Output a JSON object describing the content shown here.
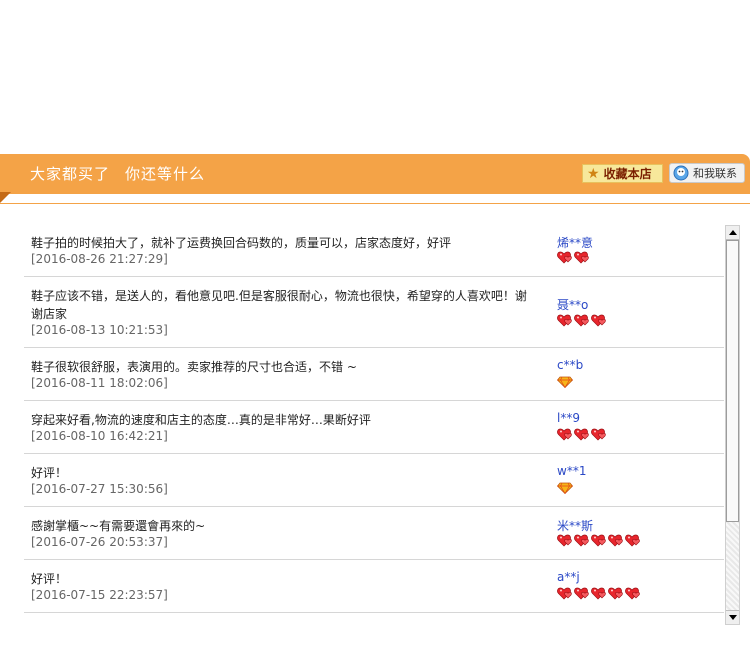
{
  "header": {
    "slogan_1": "大家都买了",
    "slogan_2": "你还等什么",
    "favorite_label": "收藏本店",
    "contact_label": "和我联系",
    "accent": "#f4a347"
  },
  "reviews": [
    {
      "comment": "鞋子拍的时候拍大了，就补了运费换回合码数的，质量可以，店家态度好，好评",
      "date": "[2016-08-26 21:27:29]",
      "user": "烯**意",
      "level_icon": "heart-icon",
      "level_count": 2
    },
    {
      "comment": "鞋子应该不错，是送人的，看他意见吧.但是客服很耐心，物流也很快，希望穿的人喜欢吧！谢谢店家",
      "date": "[2016-08-13 10:21:53]",
      "user": "聂**o",
      "level_icon": "heart-icon",
      "level_count": 3
    },
    {
      "comment": "鞋子很软很舒服，表演用的。卖家推荐的尺寸也合适，不错 ~",
      "date": "[2016-08-11 18:02:06]",
      "user": "c**b",
      "level_icon": "diamond-icon",
      "level_count": 1
    },
    {
      "comment": "穿起来好看,物流的速度和店主的态度…真的是非常好…果断好评",
      "date": "[2016-08-10 16:42:21]",
      "user": "l**9",
      "level_icon": "heart-icon",
      "level_count": 3
    },
    {
      "comment": "好评！",
      "date": "[2016-07-27 15:30:56]",
      "user": "w**1",
      "level_icon": "diamond-icon",
      "level_count": 1
    },
    {
      "comment": "感謝掌櫃~~有需要還會再來的~",
      "date": "[2016-07-26 20:53:37]",
      "user": "米**斯",
      "level_icon": "heart-icon",
      "level_count": 5
    },
    {
      "comment": "好评！",
      "date": "[2016-07-15 22:23:57]",
      "user": "a**j",
      "level_icon": "heart-icon",
      "level_count": 5
    }
  ]
}
